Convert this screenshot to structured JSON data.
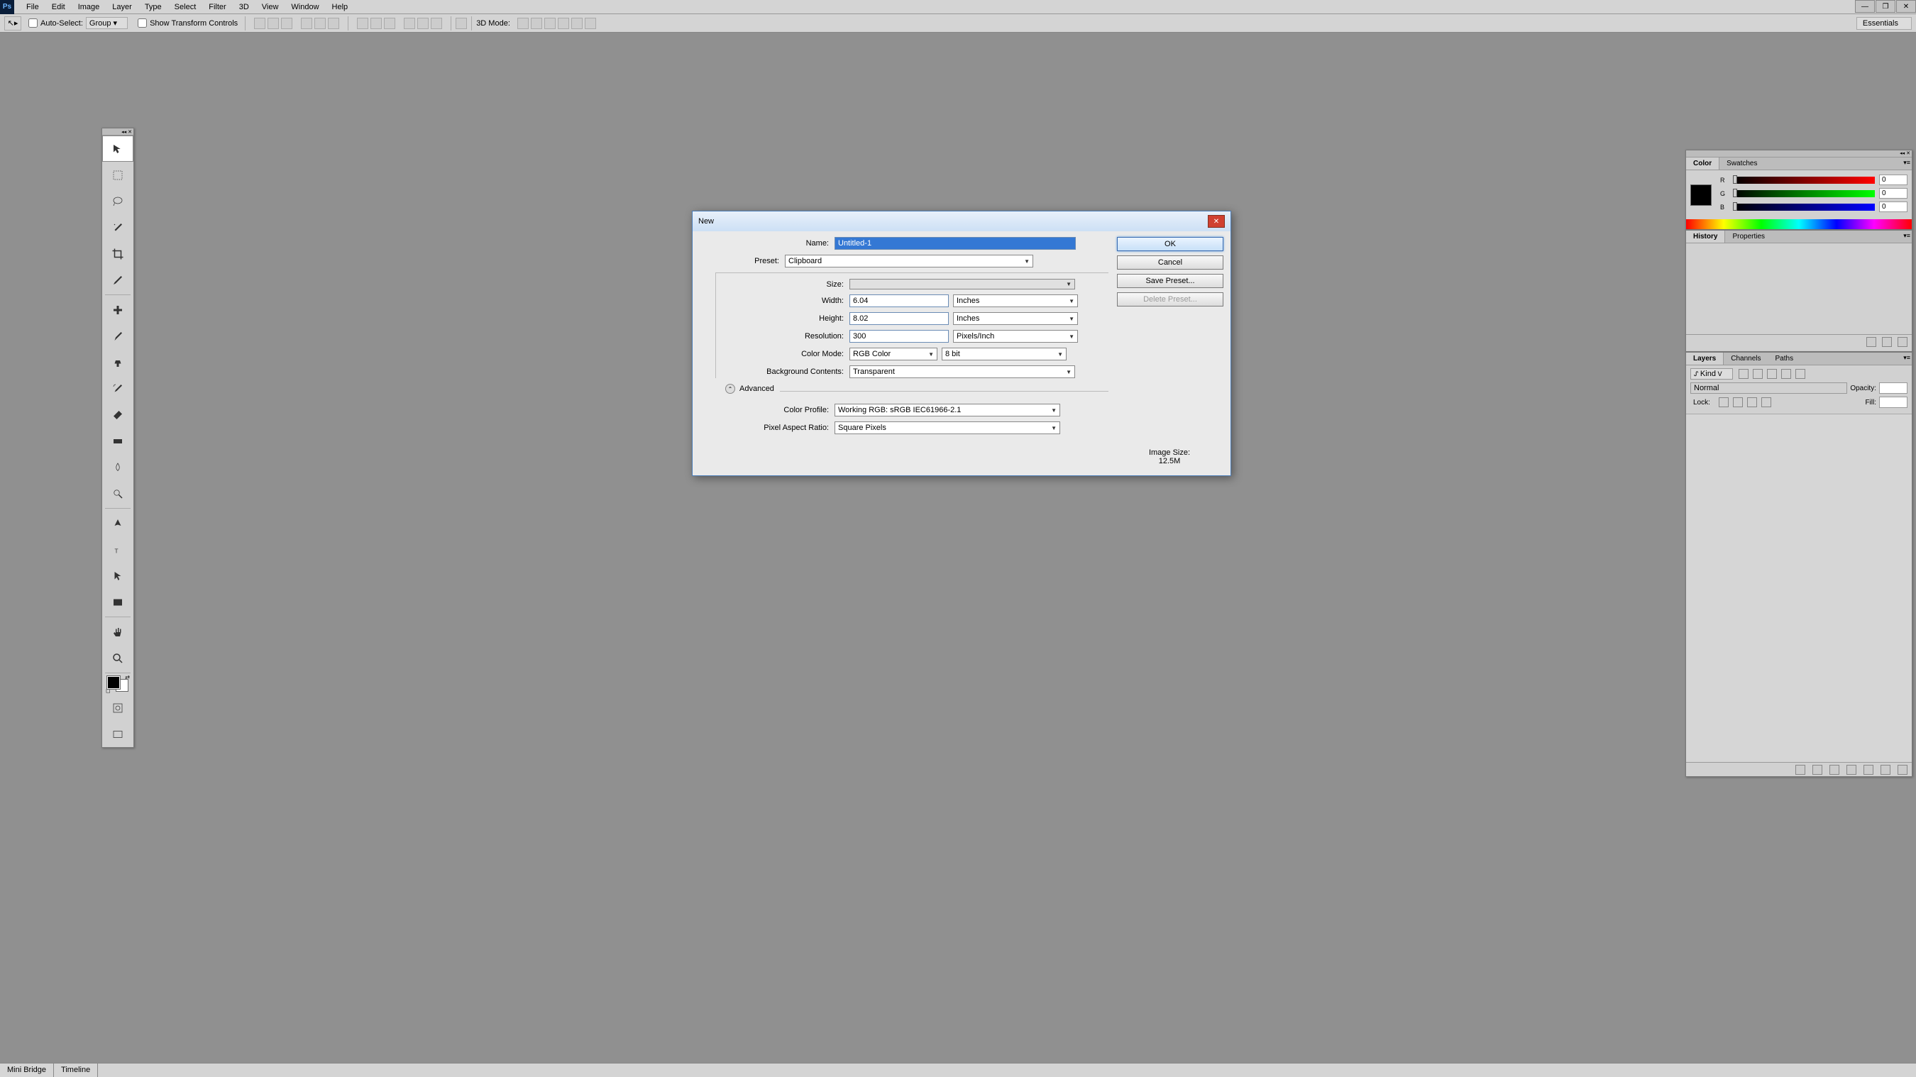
{
  "menubar": {
    "items": [
      "File",
      "Edit",
      "Image",
      "Layer",
      "Type",
      "Select",
      "Filter",
      "3D",
      "View",
      "Window",
      "Help"
    ],
    "logo": "Ps"
  },
  "options": {
    "auto_select_label": "Auto-Select:",
    "group_label": "Group",
    "show_transform_label": "Show Transform Controls",
    "mode3d_label": "3D Mode:",
    "workspace": "Essentials"
  },
  "dialog": {
    "title": "New",
    "name_label": "Name:",
    "name_value": "Untitled-1",
    "preset_label": "Preset:",
    "preset_value": "Clipboard",
    "size_label": "Size:",
    "size_value": "",
    "width_label": "Width:",
    "width_value": "6.04",
    "width_unit": "Inches",
    "height_label": "Height:",
    "height_value": "8.02",
    "height_unit": "Inches",
    "resolution_label": "Resolution:",
    "resolution_value": "300",
    "resolution_unit": "Pixels/Inch",
    "color_mode_label": "Color Mode:",
    "color_mode_value": "RGB Color",
    "bit_depth": "8 bit",
    "bg_label": "Background Contents:",
    "bg_value": "Transparent",
    "advanced_label": "Advanced",
    "color_profile_label": "Color Profile:",
    "color_profile_value": "Working RGB:  sRGB IEC61966-2.1",
    "pixel_aspect_label": "Pixel Aspect Ratio:",
    "pixel_aspect_value": "Square Pixels",
    "ok": "OK",
    "cancel": "Cancel",
    "save_preset": "Save Preset...",
    "delete_preset": "Delete Preset...",
    "image_size_label": "Image Size:",
    "image_size_value": "12.5M"
  },
  "panels": {
    "color_tab": "Color",
    "swatches_tab": "Swatches",
    "r_val": "0",
    "g_val": "0",
    "b_val": "0",
    "history_tab": "History",
    "properties_tab": "Properties",
    "layers_tab": "Layers",
    "channels_tab": "Channels",
    "paths_tab": "Paths",
    "kind_label": "Kind",
    "blend_mode": "Normal",
    "opacity_label": "Opacity:",
    "lock_label": "Lock:",
    "fill_label": "Fill:"
  },
  "bottom": {
    "mini_bridge": "Mini Bridge",
    "timeline": "Timeline"
  }
}
